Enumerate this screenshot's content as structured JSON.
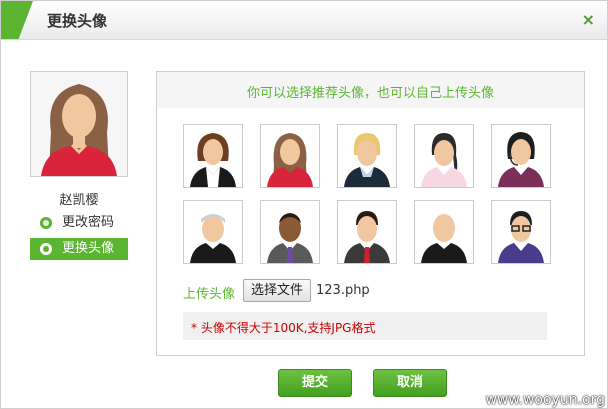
{
  "dialog": {
    "title": "更换头像",
    "close_icon": "close-icon",
    "accent_color": "#5cb531"
  },
  "sidebar": {
    "username": "赵凯樱",
    "items": [
      {
        "label": "更改密码",
        "icon": "gear-icon",
        "active": false
      },
      {
        "label": "更换头像",
        "icon": "gear-icon",
        "active": true
      }
    ]
  },
  "panel": {
    "hint": "你可以选择推荐头像，也可以自己上传头像",
    "avatars": [
      "avatar-female-1",
      "avatar-female-2",
      "avatar-female-3",
      "avatar-female-4",
      "avatar-female-headset",
      "avatar-male-bandana",
      "avatar-male-suit-dark",
      "avatar-male-headset",
      "avatar-male-bald",
      "avatar-male-glasses"
    ],
    "upload_label": "上传头像",
    "file_button": "选择文件",
    "file_name": "123.php",
    "notice": "* 头像不得大于100K,支持JPG格式"
  },
  "buttons": {
    "submit": "提交",
    "cancel": "取消"
  },
  "watermark": "www.wooyun.org"
}
